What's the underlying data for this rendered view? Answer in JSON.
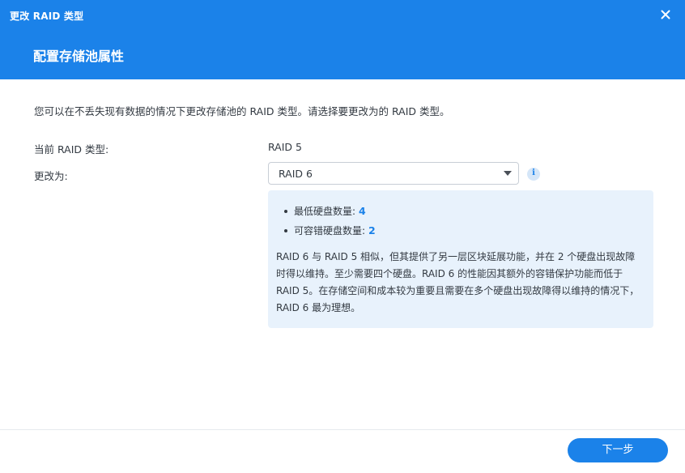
{
  "window": {
    "title": "更改 RAID 类型",
    "close_icon": "close-icon"
  },
  "step": {
    "title": "配置存储池属性"
  },
  "main": {
    "description": "您可以在不丢失现有数据的情况下更改存储池的 RAID 类型。请选择要更改为的 RAID 类型。",
    "current_raid": {
      "label": "当前 RAID 类型:",
      "value": "RAID 5"
    },
    "change_to": {
      "label": "更改为:",
      "selected": "RAID 6"
    },
    "info_icon": "info-icon",
    "info_box": {
      "min_disks_label": "最低硬盘数量:",
      "min_disks_value": "4",
      "fault_tolerance_label": "可容错硬盘数量:",
      "fault_tolerance_value": "2",
      "paragraph": "RAID 6 与 RAID 5 相似，但其提供了另一层区块延展功能，并在 2 个硬盘出现故障时得以维持。至少需要四个硬盘。RAID 6 的性能因其额外的容错保护功能而低于 RAID 5。在存储空间和成本较为重要且需要在多个硬盘出现故障得以维持的情况下，RAID 6 最为理想。"
    }
  },
  "footer": {
    "next_label": "下一步"
  },
  "colors": {
    "accent": "#1b82e9",
    "info_bg": "#e8f2fc",
    "text": "#333a42"
  }
}
